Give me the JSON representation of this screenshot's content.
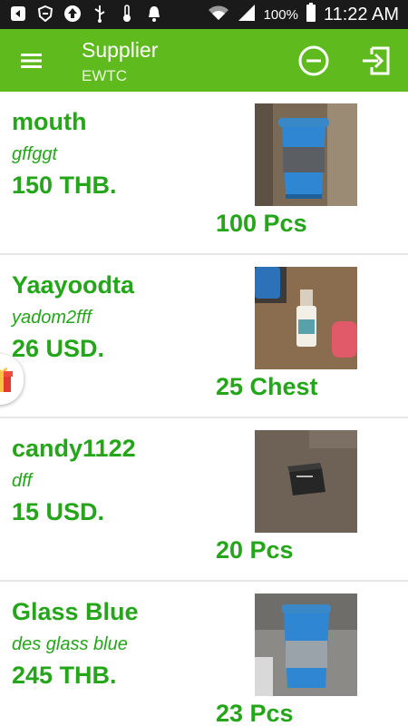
{
  "status_bar": {
    "battery_percent": "100%",
    "time": "11:22 AM",
    "icons": [
      "back-box-icon",
      "shield-icon",
      "upload-icon",
      "usb-icon",
      "thermometer-icon",
      "bell-icon",
      "wifi-icon",
      "signal-icon",
      "battery-icon"
    ]
  },
  "app_bar": {
    "title": "Supplier",
    "subtitle": "EWTC",
    "menu_icon": "hamburger-icon",
    "actions": [
      "minus-circle-icon",
      "exit-icon"
    ],
    "color": "#5fba1e"
  },
  "items": [
    {
      "name": "mouth",
      "description": "gffggt",
      "price": "150 THB.",
      "quantity": "100 Pcs",
      "image": "blue tumbler photo"
    },
    {
      "name": "Yaayoodta",
      "description": "yadom2fff",
      "price": "26 USD.",
      "quantity": "25 Chest",
      "image": "small bottle photo"
    },
    {
      "name": "candy1122",
      "description": "dff",
      "price": "15 USD.",
      "quantity": "20 Pcs",
      "image": "small black box photo"
    },
    {
      "name": "Glass Blue",
      "description": "des glass blue",
      "price": "245 THB.",
      "quantity": "23 Pcs",
      "image": "blue tumbler photo"
    }
  ],
  "accent_color": "#24a51a"
}
